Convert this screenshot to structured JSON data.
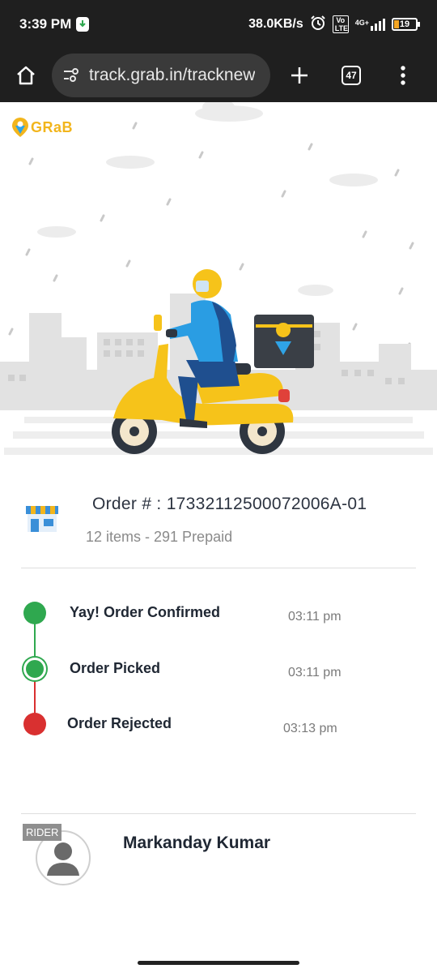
{
  "status_bar": {
    "time": "3:39 PM",
    "network_speed": "38.0KB/s",
    "network_type": "4G+",
    "volte": "Vo LTE",
    "battery": "19"
  },
  "browser": {
    "url": "track.grab.in/tracknew",
    "tab_count": "47"
  },
  "brand": {
    "logo_text": "GRaB",
    "accent": "#f2b51c"
  },
  "order": {
    "number_label": "Order # : 17332112500072006A-01",
    "summary": "12 items - 291 Prepaid"
  },
  "timeline": [
    {
      "label": "Yay! Order Confirmed",
      "time": "03:11 pm",
      "color": "#2fa84f"
    },
    {
      "label": "Order Picked",
      "time": "03:11 pm",
      "color": "#2fa84f"
    },
    {
      "label": "Order Rejected",
      "time": "03:13 pm",
      "color": "#d93030"
    }
  ],
  "rider": {
    "tag": "RIDER",
    "name": "Markanday Kumar"
  },
  "icons": [
    "home-icon",
    "site-settings-icon",
    "plus-icon",
    "tabs-icon",
    "more-vert-icon",
    "store-icon",
    "avatar-icon",
    "alarm-icon",
    "signal-icon",
    "battery-icon"
  ]
}
